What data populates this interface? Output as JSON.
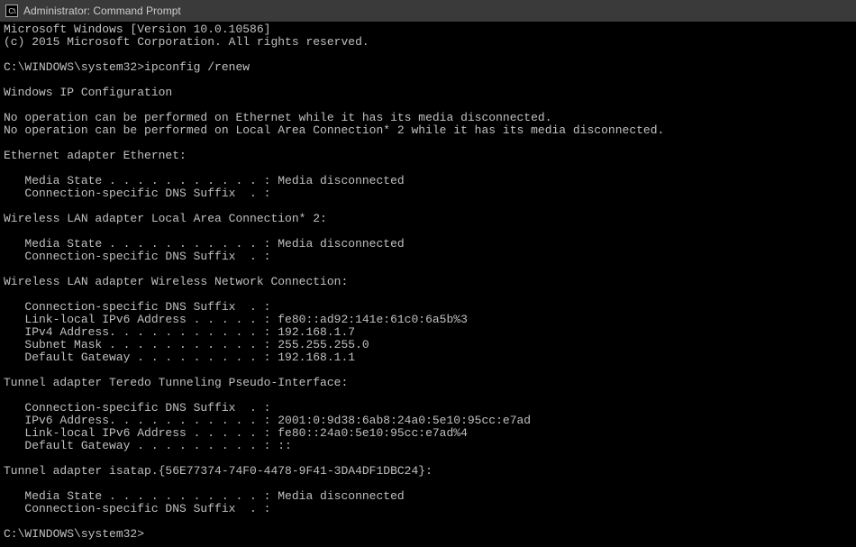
{
  "titlebar": {
    "icon_text": "C:\\",
    "title": "Administrator: Command Prompt"
  },
  "terminal": {
    "lines": [
      "Microsoft Windows [Version 10.0.10586]",
      "(c) 2015 Microsoft Corporation. All rights reserved.",
      "",
      "C:\\WINDOWS\\system32>ipconfig /renew",
      "",
      "Windows IP Configuration",
      "",
      "No operation can be performed on Ethernet while it has its media disconnected.",
      "No operation can be performed on Local Area Connection* 2 while it has its media disconnected.",
      "",
      "Ethernet adapter Ethernet:",
      "",
      "   Media State . . . . . . . . . . . : Media disconnected",
      "   Connection-specific DNS Suffix  . :",
      "",
      "Wireless LAN adapter Local Area Connection* 2:",
      "",
      "   Media State . . . . . . . . . . . : Media disconnected",
      "   Connection-specific DNS Suffix  . :",
      "",
      "Wireless LAN adapter Wireless Network Connection:",
      "",
      "   Connection-specific DNS Suffix  . :",
      "   Link-local IPv6 Address . . . . . : fe80::ad92:141e:61c0:6a5b%3",
      "   IPv4 Address. . . . . . . . . . . : 192.168.1.7",
      "   Subnet Mask . . . . . . . . . . . : 255.255.255.0",
      "   Default Gateway . . . . . . . . . : 192.168.1.1",
      "",
      "Tunnel adapter Teredo Tunneling Pseudo-Interface:",
      "",
      "   Connection-specific DNS Suffix  . :",
      "   IPv6 Address. . . . . . . . . . . : 2001:0:9d38:6ab8:24a0:5e10:95cc:e7ad",
      "   Link-local IPv6 Address . . . . . : fe80::24a0:5e10:95cc:e7ad%4",
      "   Default Gateway . . . . . . . . . : ::",
      "",
      "Tunnel adapter isatap.{56E77374-74F0-4478-9F41-3DA4DF1DBC24}:",
      "",
      "   Media State . . . . . . . . . . . : Media disconnected",
      "   Connection-specific DNS Suffix  . :",
      "",
      "C:\\WINDOWS\\system32>"
    ]
  }
}
